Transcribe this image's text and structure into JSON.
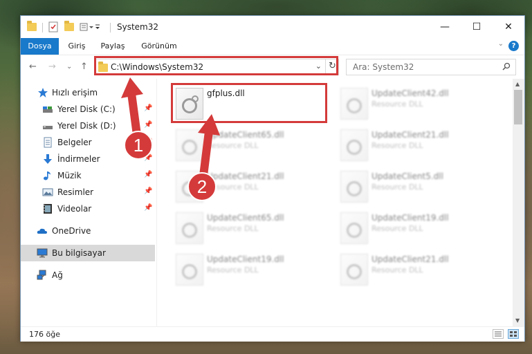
{
  "window": {
    "title": "System32",
    "controls": {
      "minimize": "—",
      "maximize": "☐",
      "close": "✕"
    }
  },
  "ribbon": {
    "tabs": [
      "Dosya",
      "Giriş",
      "Paylaş",
      "Görünüm"
    ],
    "help": "?",
    "expand": "⌄"
  },
  "nav": {
    "back": "←",
    "forward": "→",
    "recent": "⌄",
    "up": "↑",
    "address": "C:\\Windows\\System32",
    "address_dropdown": "⌄",
    "refresh": "↻",
    "search_placeholder": "Ara: System32"
  },
  "sidebar": {
    "items": [
      {
        "label": "Hızlı erişim",
        "icon": "star-icon",
        "pinned": false
      },
      {
        "label": "Yerel Disk (C:)",
        "icon": "drive-icon",
        "pinned": true
      },
      {
        "label": "Yerel Disk (D:)",
        "icon": "drive-icon",
        "pinned": true
      },
      {
        "label": "Belgeler",
        "icon": "documents-icon",
        "pinned": true
      },
      {
        "label": "İndirmeler",
        "icon": "downloads-icon",
        "pinned": true
      },
      {
        "label": "Müzik",
        "icon": "music-icon",
        "pinned": true
      },
      {
        "label": "Resimler",
        "icon": "pictures-icon",
        "pinned": true
      },
      {
        "label": "Videolar",
        "icon": "videos-icon",
        "pinned": true
      },
      {
        "label": "OneDrive",
        "icon": "cloud-icon",
        "pinned": false
      },
      {
        "label": "Bu bilgisayar",
        "icon": "computer-icon",
        "pinned": false,
        "selected": true
      },
      {
        "label": "Ağ",
        "icon": "network-icon",
        "pinned": false
      }
    ],
    "pin_glyph": "📌"
  },
  "files": [
    {
      "name": "gfplus.dll",
      "type": "",
      "blurred": false
    },
    {
      "name": "UpdateClient42.dll",
      "type": "Resource DLL",
      "blurred": true
    },
    {
      "name": "UpdateClient65.dll",
      "type": "Resource DLL",
      "blurred": true
    },
    {
      "name": "UpdateClient21.dll",
      "type": "Resource DLL",
      "blurred": true
    },
    {
      "name": "UpdateClient21.dll",
      "type": "Resource DLL",
      "blurred": true
    },
    {
      "name": "UpdateClient5.dll",
      "type": "Resource DLL",
      "blurred": true
    },
    {
      "name": "UpdateClient65.dll",
      "type": "Resource DLL",
      "blurred": true
    },
    {
      "name": "UpdateClient19.dll",
      "type": "Resource DLL",
      "blurred": true
    },
    {
      "name": "UpdateClient19.dll",
      "type": "Resource DLL",
      "blurred": true
    },
    {
      "name": "UpdateClient21.dll",
      "type": "Resource DLL",
      "blurred": true
    }
  ],
  "status": {
    "item_count": "176 öğe"
  },
  "annotations": {
    "step1": "1",
    "step2": "2",
    "color": "#d43a3a"
  },
  "colors": {
    "accent": "#1979ca",
    "highlight": "#d43a3a",
    "selected_bg": "#d9d9d9"
  }
}
